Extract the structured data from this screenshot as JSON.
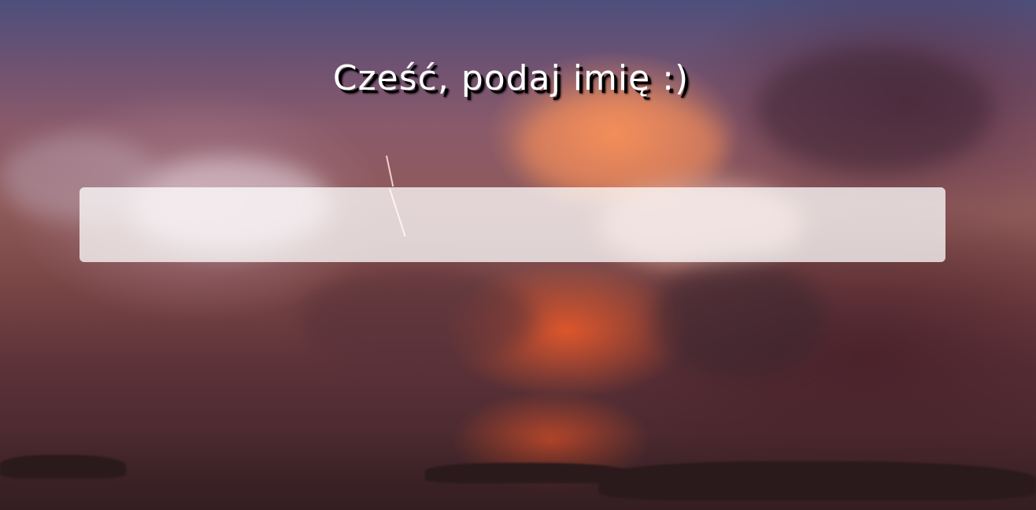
{
  "page": {
    "title": "Cześć, podaj imię :)"
  },
  "name_input": {
    "value": "",
    "placeholder": ""
  },
  "colors": {
    "title_text": "#ffffff",
    "title_shadow": "#000000",
    "input_background": "rgba(255,255,255,0.75)"
  }
}
